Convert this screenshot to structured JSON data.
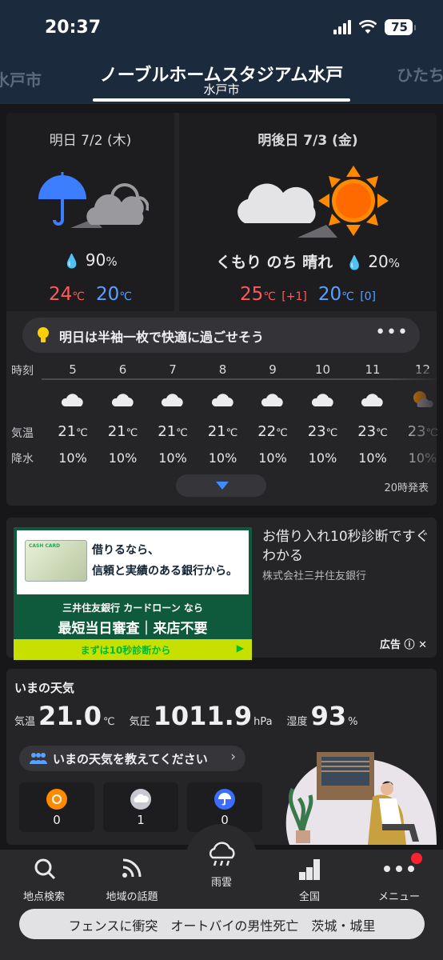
{
  "status": {
    "time": "20:37",
    "battery": "75"
  },
  "location": {
    "title": "ノーブルホームスタジアム水戸",
    "subtitle": "水戸市",
    "prev": "水戸市",
    "next": "ひたち"
  },
  "forecast": {
    "day1": {
      "title": "明日 7/2 (木)",
      "pop": "90",
      "pop_unit": "%",
      "high": "24",
      "low": "20",
      "unit": "℃"
    },
    "day2": {
      "title": "明後日 7/3 (金)",
      "weather": "くもり のち 晴れ",
      "pop": "20",
      "pop_unit": "%",
      "high": "25",
      "high_diff": "[+1]",
      "low": "20",
      "low_diff": "[0]",
      "unit": "℃"
    },
    "tip": "明日は半袖一枚で快適に過ごせそう",
    "tip_more": "•••"
  },
  "hourly": {
    "labels": {
      "time": "時刻",
      "temp": "気温",
      "pop": "降水"
    },
    "hours": [
      {
        "time": "5",
        "temp": "21",
        "pop": "10%",
        "icon": "cloud-icon"
      },
      {
        "time": "6",
        "temp": "21",
        "pop": "10%",
        "icon": "cloud-icon"
      },
      {
        "time": "7",
        "temp": "21",
        "pop": "10%",
        "icon": "cloud-icon"
      },
      {
        "time": "8",
        "temp": "21",
        "pop": "10%",
        "icon": "cloud-icon"
      },
      {
        "time": "9",
        "temp": "22",
        "pop": "10%",
        "icon": "cloud-icon"
      },
      {
        "time": "10",
        "temp": "23",
        "pop": "10%",
        "icon": "cloud-icon"
      },
      {
        "time": "11",
        "temp": "23",
        "pop": "10%",
        "icon": "cloud-icon"
      },
      {
        "time": "12",
        "temp": "23",
        "pop": "10%",
        "icon": "sun-cloud-icon"
      }
    ],
    "unit": "℃",
    "issued": "20時発表"
  },
  "ad": {
    "banner_line1": "借りるなら、",
    "banner_line2": "信頼と実績のある銀行から。",
    "banner_line3": "三井住友銀行 カードローン なら",
    "banner_line4": "最短当日審査｜来店不要",
    "banner_cta": "まずは10秒診断から",
    "card_text": "CASH CARD",
    "headline": "お借り入れ10秒診断ですぐわかる",
    "sponsor": "株式会社三井住友銀行",
    "label": "広告"
  },
  "now": {
    "title": "いまの天気",
    "temp_label": "気温",
    "temp": "21.0",
    "temp_unit": "℃",
    "pressure_label": "気圧",
    "pressure": "1011.9",
    "pressure_unit": "hPa",
    "humidity_label": "湿度",
    "humidity": "93",
    "humidity_unit": "%",
    "ask": "いまの天気を教えてください",
    "votes": [
      {
        "icon": "sun-icon",
        "count": "0"
      },
      {
        "icon": "cloud-icon",
        "count": "1"
      },
      {
        "icon": "umbrella-icon",
        "count": "0"
      }
    ]
  },
  "tabs": [
    {
      "label": "地点検索",
      "icon": "search-icon"
    },
    {
      "label": "地域の話題",
      "icon": "rss-icon"
    },
    {
      "label": "雨雲",
      "icon": "rain-cloud-icon"
    },
    {
      "label": "全国",
      "icon": "bar-chart-icon"
    },
    {
      "label": "メニュー",
      "icon": "more-icon"
    }
  ],
  "news_ticker": "フェンスに衝突　オートバイの男性死亡　茨城・城里",
  "colors": {
    "header_bg": "#1b2a3c",
    "hot": "#ff5a5a",
    "cold": "#5aa0ff",
    "accent": "#3d8cff",
    "sun": "#ff8a00"
  }
}
